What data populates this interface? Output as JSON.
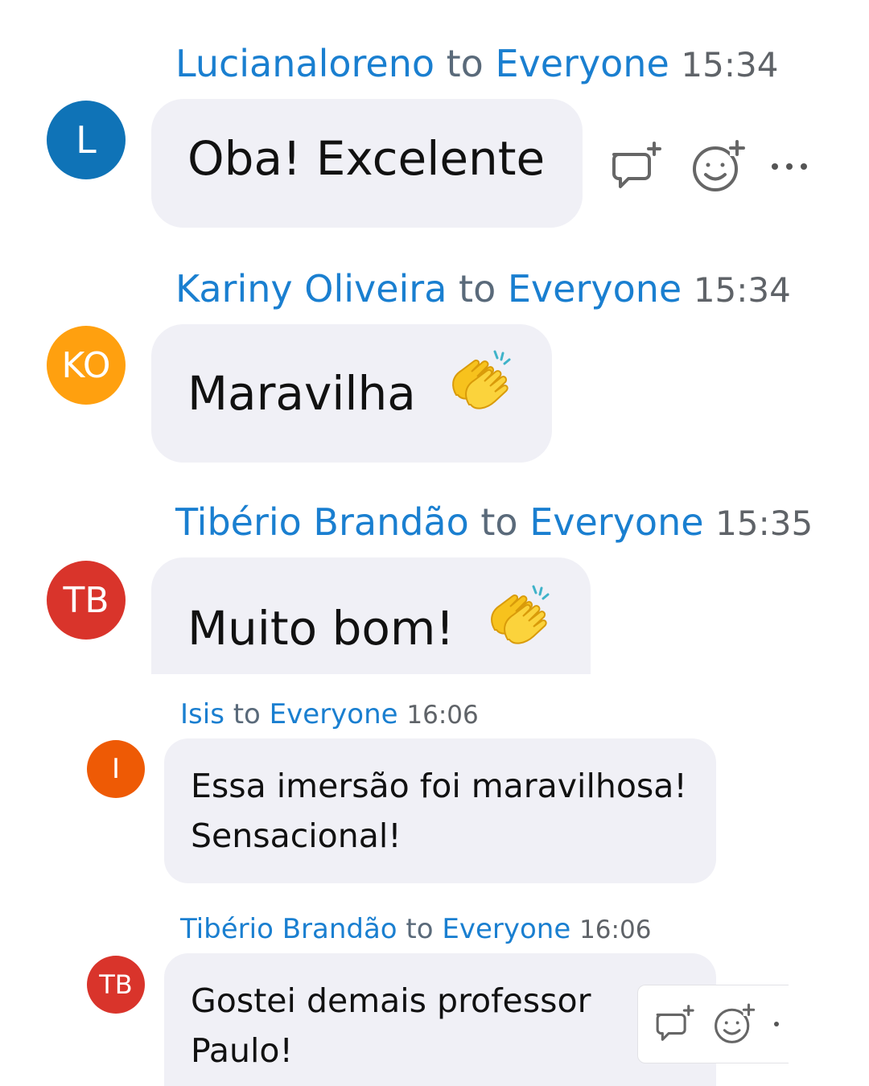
{
  "messages": [
    {
      "sender": "Lucianaloreno",
      "to_word": "to",
      "target": "Everyone",
      "time": "15:34",
      "avatar_initials": "L",
      "avatar_color": "#0f73b7",
      "text_lines": [
        "Oba! Excelente"
      ],
      "actions": [
        "reply-icon",
        "add-reaction-icon",
        "more-options-icon"
      ]
    },
    {
      "sender": "Kariny Oliveira",
      "to_word": "to",
      "target": "Everyone",
      "time": "15:34",
      "avatar_initials": "KO",
      "avatar_color": "#ffa00f",
      "text_lines": [
        "Maravilha"
      ],
      "emoji": "clapping-hands-icon"
    },
    {
      "sender": "Tibério Brandão",
      "to_word": "to",
      "target": "Everyone",
      "time": "15:35",
      "avatar_initials": "TB",
      "avatar_color": "#d9342b",
      "text_lines": [
        "Muito bom!"
      ],
      "emoji": "clapping-hands-icon"
    },
    {
      "sender": "Isis",
      "to_word": "to",
      "target": "Everyone",
      "time": "16:06",
      "avatar_initials": "I",
      "avatar_color": "#ee5a05",
      "text_lines": [
        "Essa imersão foi maravilhosa!",
        "Sensacional!"
      ]
    },
    {
      "sender": "Tibério Brandão",
      "to_word": "to",
      "target": "Everyone",
      "time": "16:06",
      "avatar_initials": "TB",
      "avatar_color": "#d9342b",
      "text_lines": [
        "Gostei demais professor",
        "Paulo!"
      ],
      "actions": [
        "reply-icon",
        "add-reaction-icon",
        "more-options-icon"
      ]
    }
  ],
  "colors": {
    "link_blue": "#1a7fd0",
    "bubble_bg": "#f0f0f6",
    "icon_gray": "#666666"
  }
}
